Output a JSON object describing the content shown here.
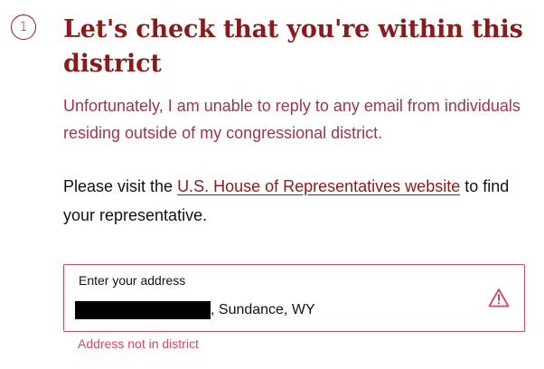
{
  "step": {
    "number": "1"
  },
  "heading": {
    "title": "Let's check that you're within this district"
  },
  "notice": {
    "text": "Unfortunately, I am unable to reply to any email from individuals residing outside of my congressional district."
  },
  "info": {
    "prefix": "Please visit the ",
    "link_text": "U.S. House of Representatives website",
    "suffix": " to find your representative."
  },
  "address": {
    "label": "Enter your address",
    "value_suffix": ", Sundance, WY",
    "error": "Address not in district",
    "icon": "warning-triangle-icon"
  },
  "colors": {
    "heading": "#8b1a1a",
    "notice": "#a0364a",
    "error": "#d9465a"
  }
}
